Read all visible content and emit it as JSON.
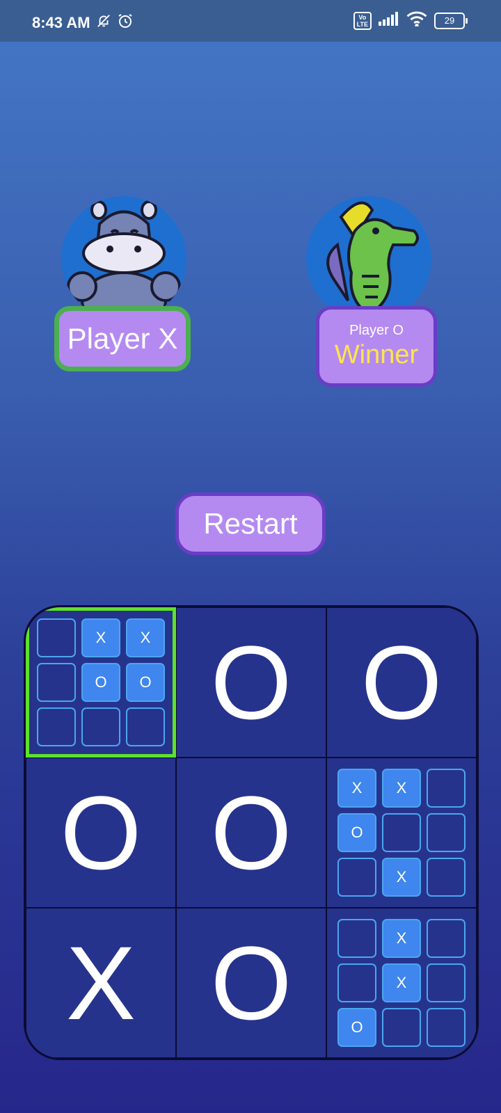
{
  "status_bar": {
    "time": "8:43 AM",
    "battery": "29",
    "volte": "Vo\nLTE"
  },
  "players": {
    "x": {
      "label": "Player X"
    },
    "o": {
      "label": "Player O",
      "status": "Winner"
    }
  },
  "restart_label": "Restart",
  "board": [
    {
      "type": "mini",
      "active": true,
      "cells": [
        "",
        "X",
        "X",
        "",
        "O",
        "O",
        "",
        "",
        ""
      ]
    },
    {
      "type": "won",
      "value": "O"
    },
    {
      "type": "won",
      "value": "O"
    },
    {
      "type": "won",
      "value": "O"
    },
    {
      "type": "won",
      "value": "O"
    },
    {
      "type": "mini",
      "active": false,
      "cells": [
        "X",
        "X",
        "",
        "O",
        "",
        "",
        "",
        "X",
        ""
      ]
    },
    {
      "type": "won",
      "value": "X"
    },
    {
      "type": "won",
      "value": "O"
    },
    {
      "type": "mini",
      "active": false,
      "cells": [
        "",
        "X",
        "",
        "",
        "X",
        "",
        "O",
        "",
        ""
      ]
    }
  ],
  "colors": {
    "accent": "#b48af0",
    "active_player_border": "#4caf50",
    "active_board_border": "#5ee22a",
    "winner_text": "#ffe54a"
  }
}
